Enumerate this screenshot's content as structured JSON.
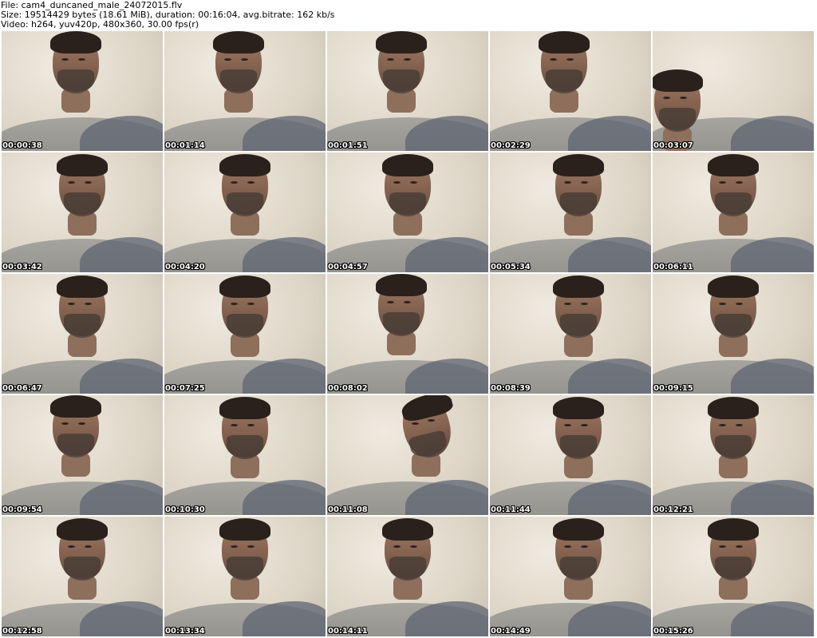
{
  "header": {
    "file_line": "File: cam4_duncaned_male_24072015.flv",
    "size_line": "Size: 19514429 bytes (18.61 MiB), duration: 00:16:04, avg.bitrate: 162 kb/s",
    "video_line": "Video: h264, yuv420p, 480x360, 30.00 fps(r)"
  },
  "frames": [
    {
      "timestamp": "00:00:38"
    },
    {
      "timestamp": "00:01:14"
    },
    {
      "timestamp": "00:01:51"
    },
    {
      "timestamp": "00:02:29"
    },
    {
      "timestamp": "00:03:07"
    },
    {
      "timestamp": "00:03:42"
    },
    {
      "timestamp": "00:04:20"
    },
    {
      "timestamp": "00:04:57"
    },
    {
      "timestamp": "00:05:34"
    },
    {
      "timestamp": "00:06:11"
    },
    {
      "timestamp": "00:06:47"
    },
    {
      "timestamp": "00:07:25"
    },
    {
      "timestamp": "00:08:02"
    },
    {
      "timestamp": "00:08:39"
    },
    {
      "timestamp": "00:09:15"
    },
    {
      "timestamp": "00:09:54"
    },
    {
      "timestamp": "00:10:30"
    },
    {
      "timestamp": "00:11:08"
    },
    {
      "timestamp": "00:11:44"
    },
    {
      "timestamp": "00:12:21"
    },
    {
      "timestamp": "00:12:58"
    },
    {
      "timestamp": "00:13:34"
    },
    {
      "timestamp": "00:14:11"
    },
    {
      "timestamp": "00:14:49"
    },
    {
      "timestamp": "00:15:26"
    }
  ]
}
